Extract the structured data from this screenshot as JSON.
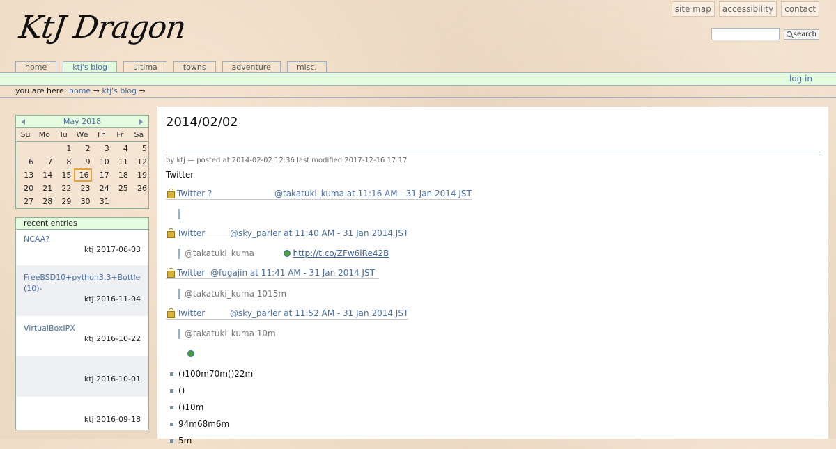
{
  "site": {
    "logo": "KtJ Dragon",
    "top_links": [
      "site map",
      "accessibility",
      "contact"
    ],
    "search": {
      "value": "",
      "button": "search"
    },
    "tabs": [
      "home",
      "ktj's blog",
      "ultima",
      "towns",
      "adventure",
      "misc."
    ],
    "active_tab": "ktj's blog",
    "login": "log in",
    "breadcrumb": {
      "prefix": "you are here:",
      "items": [
        "home",
        "ktj's blog"
      ],
      "sep": "→"
    }
  },
  "calendar": {
    "month": "May 2018",
    "dow": [
      "Su",
      "Mo",
      "Tu",
      "We",
      "Th",
      "Fr",
      "Sa"
    ],
    "days": [
      "",
      "",
      "1",
      "2",
      "3",
      "4",
      "5",
      "6",
      "7",
      "8",
      "9",
      "10",
      "11",
      "12",
      "13",
      "14",
      "15",
      "16",
      "17",
      "18",
      "19",
      "20",
      "21",
      "22",
      "23",
      "24",
      "25",
      "26",
      "27",
      "28",
      "29",
      "30",
      "31",
      "",
      ""
    ],
    "today": "16"
  },
  "recent": {
    "title": "recent entries",
    "entries": [
      {
        "title": "NCAA?",
        "meta": "ktj 2017-06-03"
      },
      {
        "title": "FreeBSD10+python3.3+Bottle (10)-",
        "meta": "ktj 2016-11-04"
      },
      {
        "title": "VirtualBoxIPX",
        "meta": "ktj 2016-10-22"
      },
      {
        "title": "",
        "meta": "ktj 2016-10-01"
      },
      {
        "title": "",
        "meta": "ktj 2016-09-18"
      }
    ]
  },
  "post": {
    "title": "2014/02/02",
    "byline": "by ktj — posted at 2014-02-02 12:36 last modified 2017-12-16 17:17",
    "subtitle": "Twitter",
    "tweets": [
      {
        "label": "Twitter ?",
        "handle": "@takatuki_kuma at 11:16 AM - 31 Jan 2014 JST",
        "quote": ""
      },
      {
        "label": "Twitter",
        "handle": "@sky_parler at 11:40 AM - 31 Jan 2014 JST",
        "quote": "@takatuki_kuma",
        "link": "http://t.co/ZFw6lRe42B"
      },
      {
        "label": "Twitter",
        "handle": "@fugajin at 11:41 AM - 31 Jan 2014 JST",
        "quote": "@takatuki_kuma 1015m"
      },
      {
        "label": "Twitter",
        "handle": "@sky_parler at 11:52 AM - 31 Jan 2014 JST",
        "quote": "@takatuki_kuma 10m"
      }
    ],
    "bullets": [
      "()100m70m()22m",
      "()",
      "()10m",
      "94m68m6m",
      "5m"
    ]
  }
}
